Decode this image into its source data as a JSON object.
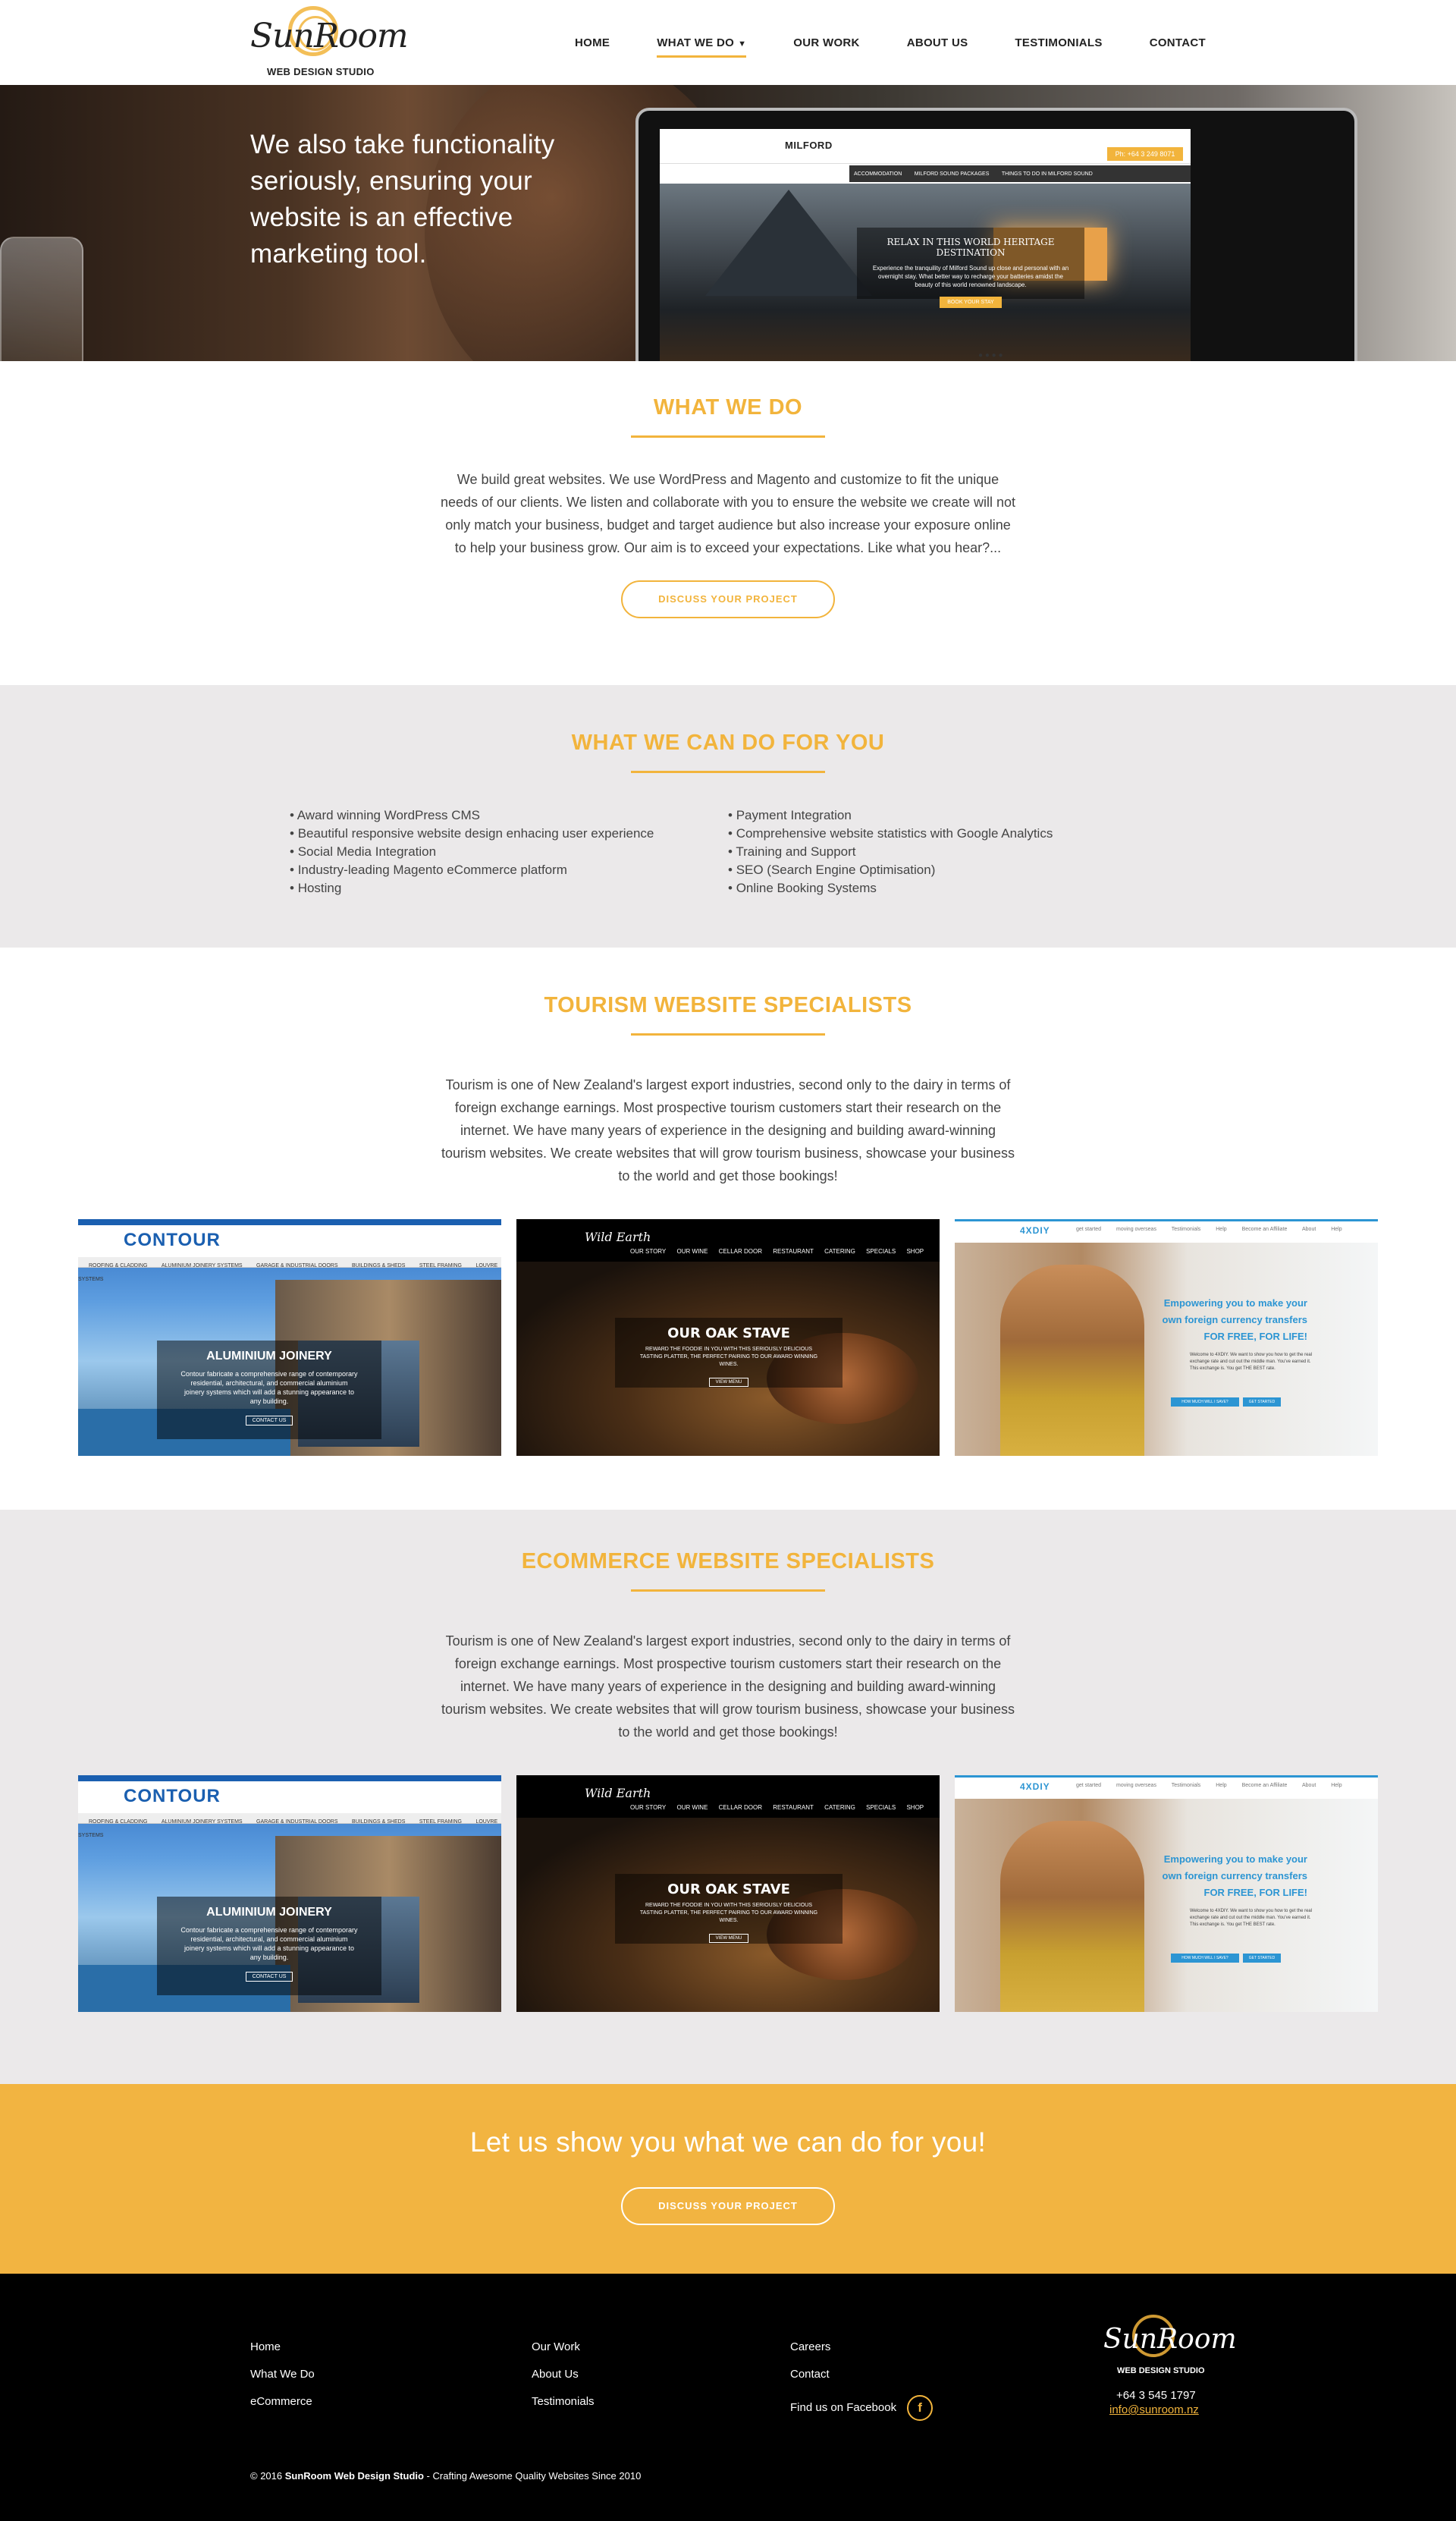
{
  "header": {
    "logo_word": "SunRoom",
    "logo_sub": "WEB DESIGN STUDIO",
    "nav": [
      {
        "label": "HOME"
      },
      {
        "label": "WHAT WE DO"
      },
      {
        "label": "OUR WORK"
      },
      {
        "label": "ABOUT US"
      },
      {
        "label": "TESTIMONIALS"
      },
      {
        "label": "CONTACT"
      }
    ],
    "active_nav": "WHAT WE DO"
  },
  "hero": {
    "text": "We also take functionality seriously, ensuring your website is an effective marketing tool.",
    "screen_brand": "MILFORD",
    "screen_phone": "Ph: +64 3 249 8071",
    "screen_menu": [
      "ACCOMMODATION",
      "MILFORD SOUND PACKAGES",
      "THINGS TO DO IN MILFORD SOUND"
    ],
    "screen_caption": "RELAX IN THIS WORLD HERITAGE DESTINATION",
    "screen_caption_text": "Experience the tranquility of Milford Sound up close and personal with an overnight stay. What better way to recharge your batteries amidst the beauty of this world renowned landscape.",
    "screen_cta": "BOOK YOUR STAY"
  },
  "what_we_do": {
    "title": "WHAT WE DO",
    "text": "We build great websites. We use WordPress and Magento and customize to fit the unique needs of our clients. We listen and collaborate with you to ensure the website we create will not only match your business, budget and target audience but also increase your exposure online to help your business grow. Our aim is to exceed your expectations. Like what you hear?...",
    "button": "DISCUSS YOUR PROJECT"
  },
  "can_do": {
    "title": "WHAT WE CAN DO FOR YOU",
    "left": [
      "Award winning WordPress CMS",
      "Beautiful responsive website design enhacing user experience",
      "Social Media Integration",
      "Industry-leading Magento eCommerce platform",
      "Hosting"
    ],
    "right": [
      "Payment Integration",
      "Comprehensive website statistics with Google Analytics",
      "Training and Support",
      "SEO (Search Engine Optimisation)",
      "Online Booking Systems"
    ]
  },
  "tourism": {
    "title": "TOURISM WEBSITE SPECIALISTS",
    "text": "Tourism is one of New Zealand's largest export industries, second only to the dairy in terms of foreign exchange earnings. Most prospective tourism customers start their research on the internet. We have many years of experience in the designing and building award-winning tourism websites. We create websites that will grow tourism business, showcase your business to the world and get those bookings!"
  },
  "ecommerce": {
    "title": "ECOMMERCE WEBSITE SPECIALISTS",
    "text": "Tourism is one of New Zealand's largest export industries, second only to the dairy in terms of foreign exchange earnings. Most prospective tourism customers start their research on the internet. We have many years of experience in the designing and building award-winning tourism websites. We create websites that will grow tourism business, showcase your business to the world and get those bookings!"
  },
  "thumbs": {
    "contour": {
      "logo": "CONTOUR",
      "menu": [
        "ROOFING & CLADDING",
        "ALUMINIUM JOINERY SYSTEMS",
        "GARAGE & INDUSTRIAL DOORS",
        "BUILDINGS & SHEDS",
        "STEEL FRAMING",
        "LOUVRE SYSTEMS"
      ],
      "heading": "ALUMINIUM JOINERY",
      "text": "Contour fabricate a comprehensive range of contemporary residential, architectural, and commercial aluminium joinery systems which will add a stunning appearance to any building.",
      "button": "CONTACT US"
    },
    "wild": {
      "logo": "Wild Earth",
      "menu": [
        "OUR STORY",
        "OUR WINE",
        "CELLAR DOOR",
        "RESTAURANT",
        "CATERING",
        "SPECIALS",
        "SHOP"
      ],
      "heading": "OUR OAK STAVE",
      "text": "REWARD THE FOODIE IN YOU WITH THIS SERIOUSLY DELICIOUS TASTING PLATTER, THE PERFECT PAIRING TO OUR AWARD WINNING WINES.",
      "button": "VIEW MENU"
    },
    "fx": {
      "logo": "4XDIY",
      "menu": [
        "get started",
        "moving overseas",
        "Testimonials",
        "Help",
        "Become an Affiliate",
        "About",
        "Help"
      ],
      "heading": "Empowering you to make your own foreign currency transfers",
      "heading2": "FOR FREE, FOR LIFE!",
      "text": "Welcome to 4XDIY. We want to show you how to get the real exchange rate and cut out the middle man. You've earned it. This exchange is. You get THE BEST rate.",
      "button1": "HOW MUCH WILL I SAVE?",
      "button2": "GET STARTED"
    }
  },
  "cta_band": {
    "heading": "Let us show you what we can do for you!",
    "button": "DISCUSS YOUR PROJECT"
  },
  "footer": {
    "col1": [
      "Home",
      "What We Do",
      "eCommerce"
    ],
    "col2": [
      "Our Work",
      "About Us",
      "Testimonials"
    ],
    "col3": [
      "Careers",
      "Contact",
      "Find us on Facebook"
    ],
    "fb_glyph": "f",
    "logo_word": "SunRoom",
    "logo_sub": "WEB DESIGN STUDIO",
    "phone": "+64 3 545 1797",
    "email": "info@sunroom.nz",
    "copyright_pre": "© 2016 ",
    "copyright_brand": "SunRoom Web Design Studio",
    "copyright_post": " - Crafting Awesome Quality Websites Since 2010"
  },
  "colors": {
    "accent": "#f2b43c",
    "grey_band": "#ebe9ea",
    "footer_bg": "#000000"
  }
}
